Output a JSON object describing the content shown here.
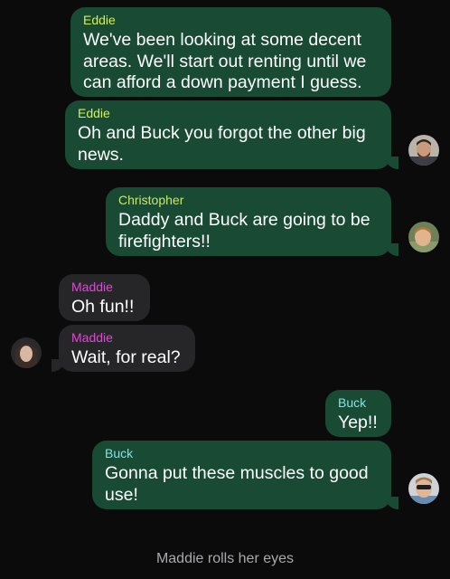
{
  "colors": {
    "background": "#0b0b0b",
    "outgoing_bubble": "#184a34",
    "incoming_bubble": "#262628",
    "eddie_name": "#d7f04a",
    "christopher_name": "#cde95c",
    "maddie_name": "#e246d9",
    "buck_name": "#7fe3e8",
    "system_text": "#a9a9ad"
  },
  "messages": [
    {
      "sender": "Eddie",
      "text": "We've been looking at some decent areas. We'll start out renting until we can afford a down payment I guess."
    },
    {
      "sender": "Eddie",
      "text": "Oh and Buck you forgot the other big news."
    },
    {
      "sender": "Christopher",
      "text": "Daddy and Buck are going to be firefighters!!"
    },
    {
      "sender": "Maddie",
      "text": "Oh fun!!"
    },
    {
      "sender": "Maddie",
      "text": "Wait, for real?"
    },
    {
      "sender": "Buck",
      "text": "Yep!!"
    },
    {
      "sender": "Buck",
      "text": "Gonna put these muscles to good use!"
    }
  ],
  "system_message": "Maddie rolls her eyes"
}
